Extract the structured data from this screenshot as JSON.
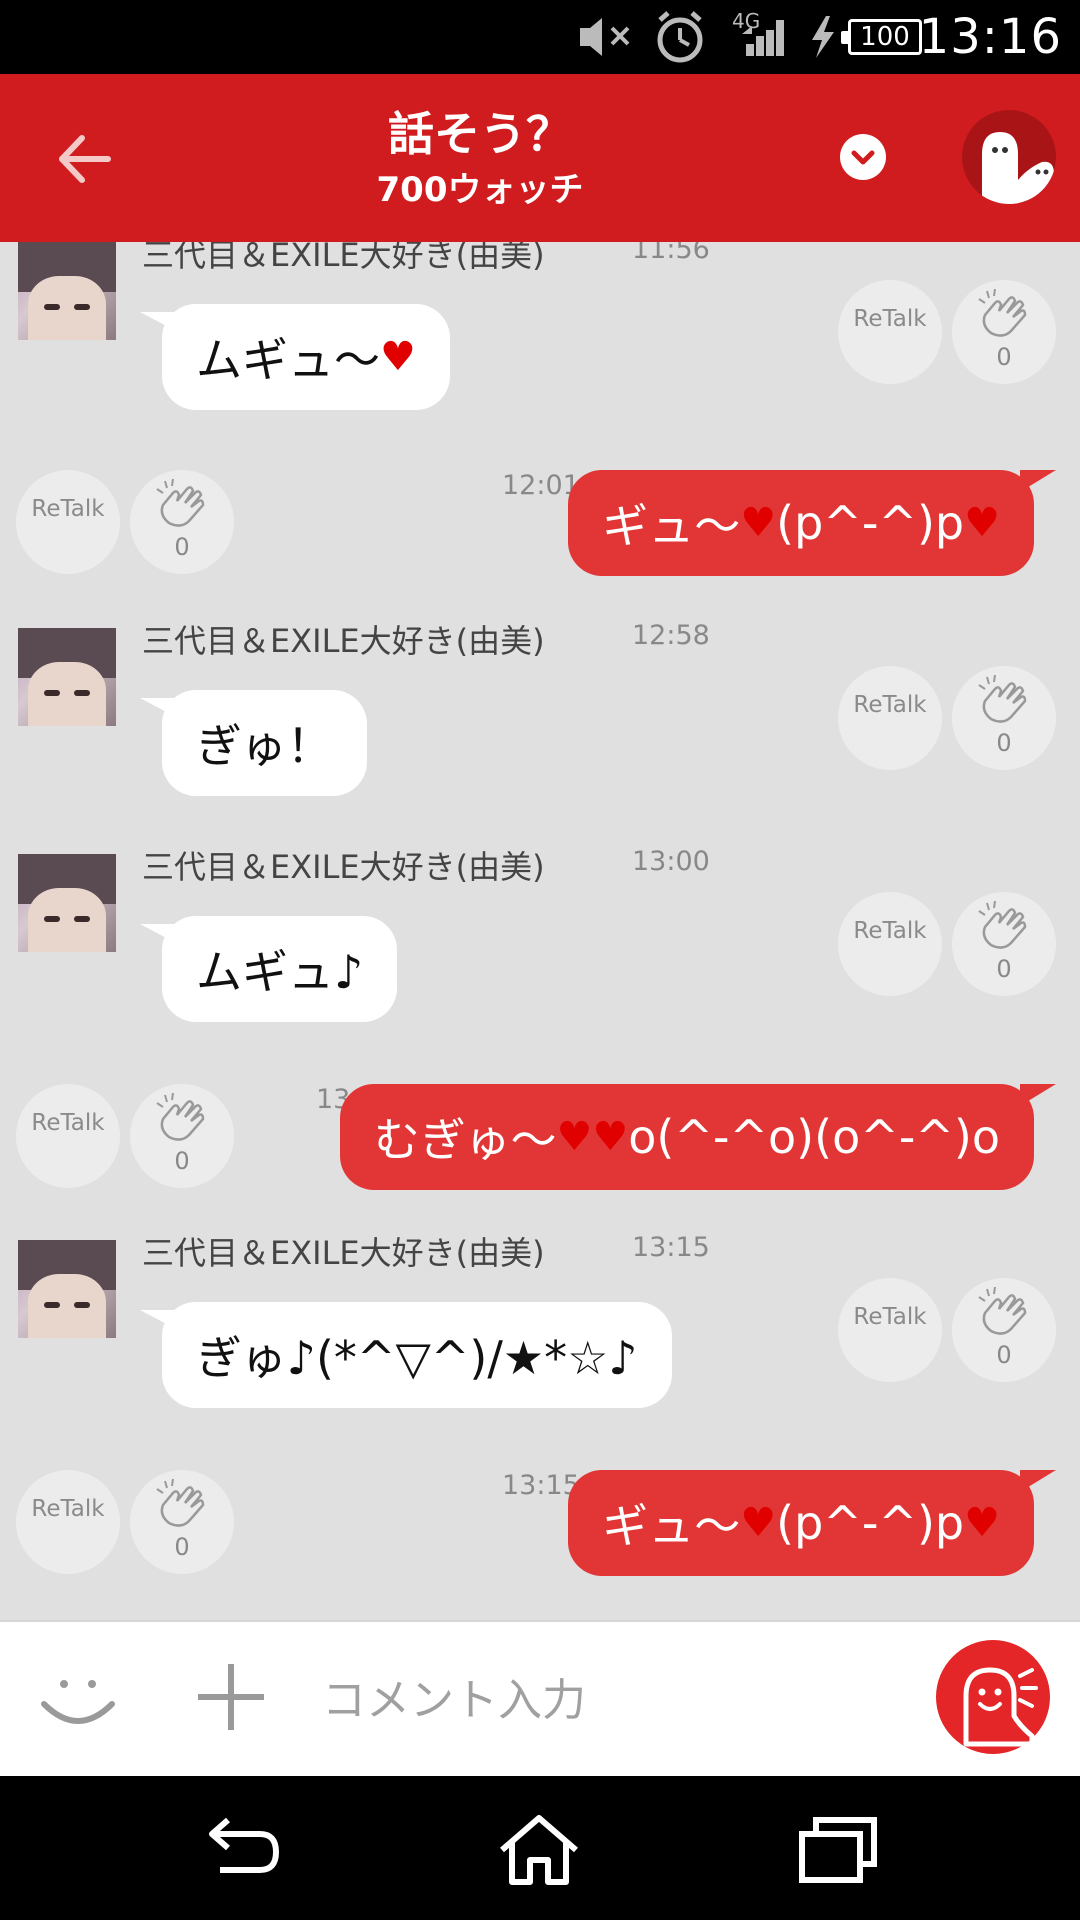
{
  "status_bar": {
    "time": "13:16",
    "battery": "100",
    "network": "4G",
    "icons": [
      "mute-icon",
      "alarm-icon",
      "signal-icon",
      "charging-icon",
      "battery-icon"
    ]
  },
  "header": {
    "title": "話そう？",
    "subtitle": "700ウォッチ",
    "accent_color": "#d01c1f"
  },
  "messages": [
    {
      "direction": "in",
      "sender": "三代目＆EXILE大好き(由美)",
      "time": "11:56",
      "text": "ムギュ〜",
      "hearts": 1,
      "retalk_label": "ReTalk",
      "clap_count": "0"
    },
    {
      "direction": "out",
      "time": "12:01",
      "text_a": "ギュ〜",
      "text_b": "(p^-^)p",
      "retalk_label": "ReTalk",
      "clap_count": "0"
    },
    {
      "direction": "in",
      "sender": "三代目＆EXILE大好き(由美)",
      "time": "12:58",
      "text": "ぎゅ！",
      "retalk_label": "ReTalk",
      "clap_count": "0"
    },
    {
      "direction": "in",
      "sender": "三代目＆EXILE大好き(由美)",
      "time": "13:00",
      "text": "ムギュ♪",
      "retalk_label": "ReTalk",
      "clap_count": "0"
    },
    {
      "direction": "out",
      "time": "13:01",
      "text_a": "むぎゅ〜",
      "text_b": "o(^-^o)(o^-^)o",
      "retalk_label": "ReTalk",
      "clap_count": "0"
    },
    {
      "direction": "in",
      "sender": "三代目＆EXILE大好き(由美)",
      "time": "13:15",
      "text": "ぎゅ♪(*^▽^)/★*☆♪",
      "retalk_label": "ReTalk",
      "clap_count": "0"
    },
    {
      "direction": "out",
      "time": "13:15",
      "text_a": "ギュ〜",
      "text_b": "(p^-^)p",
      "retalk_label": "ReTalk",
      "clap_count": "0"
    }
  ],
  "input_bar": {
    "placeholder": "コメント入力"
  },
  "nav_bar": {
    "icons": [
      "back-icon",
      "home-icon",
      "recents-icon"
    ]
  }
}
